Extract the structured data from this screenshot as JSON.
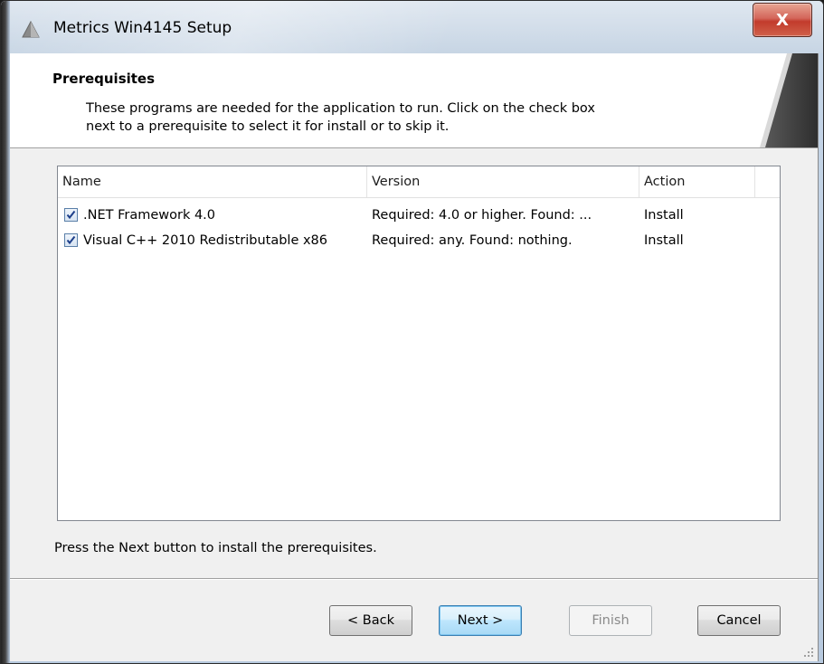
{
  "window": {
    "title": "Metrics Win4145 Setup",
    "close_label": "X"
  },
  "banner": {
    "title": "Prerequisites",
    "description_line1": "These programs are needed for the application to run. Click on the check box",
    "description_line2": "next to a prerequisite to select it for install or to skip it."
  },
  "list": {
    "columns": [
      "Name",
      "Version",
      "Action"
    ],
    "rows": [
      {
        "checked": true,
        "name": ".NET Framework 4.0",
        "version": "Required: 4.0 or higher. Found: ...",
        "action": "Install"
      },
      {
        "checked": true,
        "name": "Visual C++ 2010 Redistributable x86",
        "version": "Required: any. Found: nothing.",
        "action": "Install"
      }
    ]
  },
  "hint": "Press the Next button to install the prerequisites.",
  "buttons": {
    "back": "< Back",
    "next": "Next >",
    "finish": "Finish",
    "cancel": "Cancel"
  },
  "colors": {
    "close_button": "#c23b2c",
    "default_button_border": "#3c7fb1",
    "checkbox_border": "#5a7fa8",
    "disabled_text": "#8a8a8a"
  }
}
